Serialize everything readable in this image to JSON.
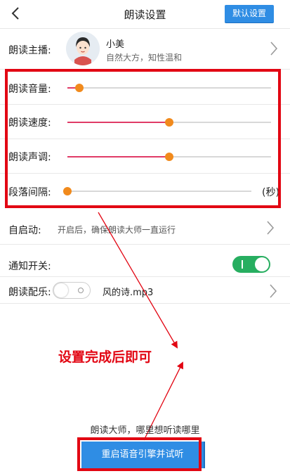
{
  "header": {
    "title": "朗读设置",
    "default_button": "默认设置"
  },
  "anchor": {
    "label": "朗读主播:",
    "name": "小美",
    "description": "自然大方，知性温和"
  },
  "sliders": {
    "volume": {
      "label": "朗读音量:",
      "value": 0.06
    },
    "speed": {
      "label": "朗读速度:",
      "value": 0.5
    },
    "pitch": {
      "label": "朗读声调:",
      "value": 0.5
    },
    "paragraph_interval": {
      "label": "段落间隔:",
      "value": 0.0,
      "unit": "(秒)"
    }
  },
  "auto_start": {
    "label": "自启动:",
    "description": "开启后，确保朗读大师一直运行"
  },
  "notification": {
    "label": "通知开关:",
    "enabled": true
  },
  "music": {
    "label": "朗读配乐:",
    "enabled": false,
    "file": "风的诗.mp3"
  },
  "annotation": {
    "text": "设置完成后即可"
  },
  "footer": {
    "slogan": "朗读大师，哪里想听读哪里",
    "restart_button": "重启语音引擎并试听"
  },
  "colors": {
    "accent_blue": "#2f8de4",
    "highlight_red": "#e20613",
    "slider_fill": "#e03b67",
    "slider_thumb": "#f18a1c",
    "toggle_on": "#27ae60"
  }
}
